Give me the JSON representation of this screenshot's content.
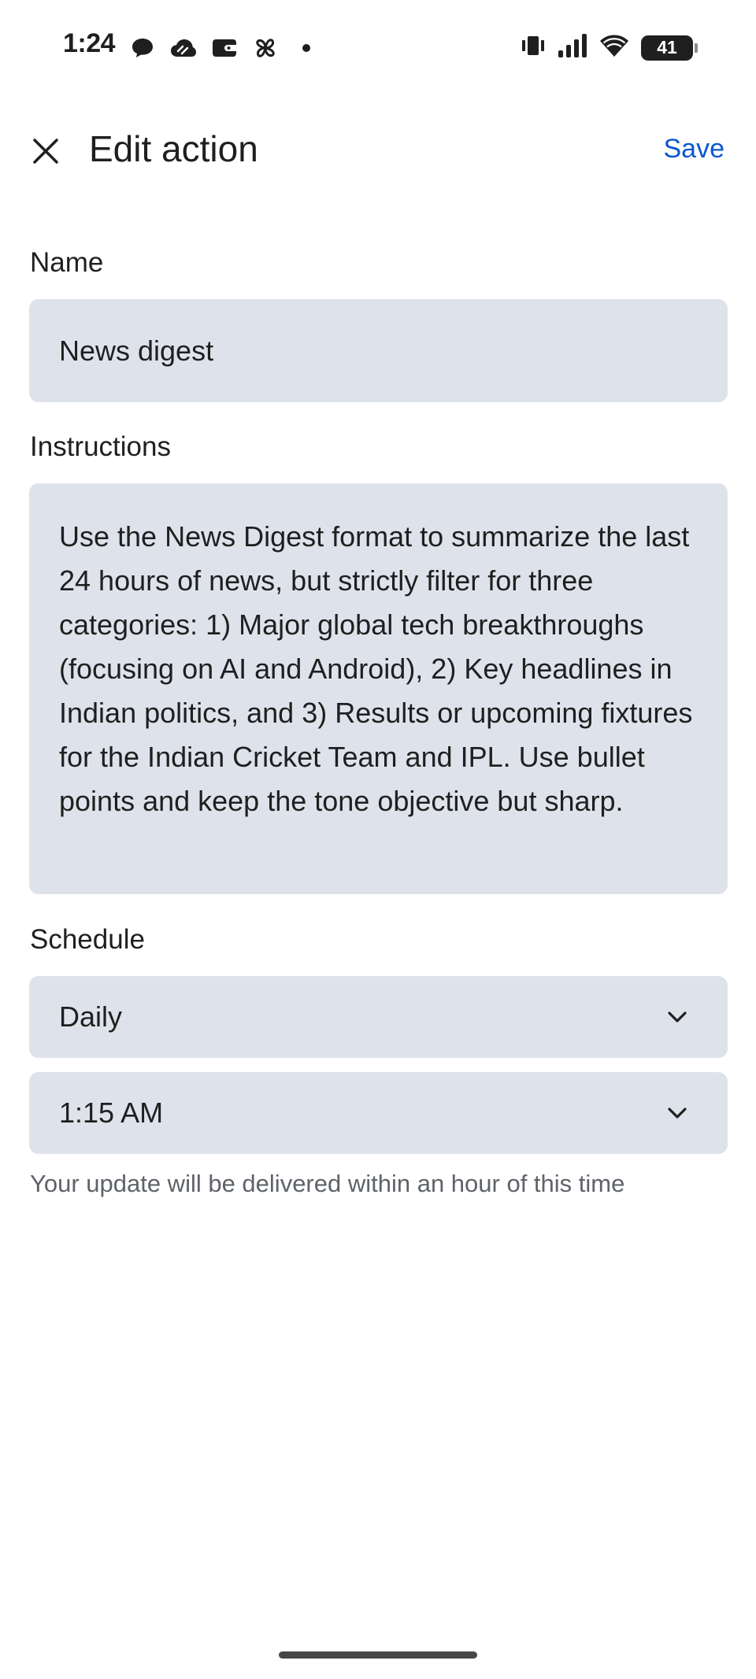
{
  "status_bar": {
    "time": "1:24",
    "battery_level": "41",
    "notification_icons": [
      "chat-bubble-icon",
      "cloud-icon",
      "wallet-icon",
      "pinwheel-icon",
      "more-dot-icon"
    ],
    "system_icons": [
      "vibrate-icon",
      "signal-icon",
      "wifi-icon",
      "battery-icon"
    ]
  },
  "app_bar": {
    "title": "Edit action",
    "save_label": "Save",
    "close_icon": "close-icon"
  },
  "form": {
    "name": {
      "label": "Name",
      "value": "News digest"
    },
    "instructions": {
      "label": "Instructions",
      "value": "Use the News Digest format to summarize the last 24 hours of news, but strictly filter for three categories: 1) Major global tech breakthroughs (focusing on AI and Android), 2) Key headlines in Indian politics, and 3) Results or upcoming fixtures for the Indian Cricket Team and IPL. Use bullet points and keep the tone objective but sharp."
    },
    "schedule": {
      "label": "Schedule",
      "frequency": "Daily",
      "time": "1:15 AM",
      "hint": "Your update will be delivered within an hour of this time"
    }
  },
  "colors": {
    "accent": "#0b57d0",
    "field_background": "#dee3eb",
    "text_primary": "#1f1f1f",
    "text_secondary": "#5f6368"
  }
}
